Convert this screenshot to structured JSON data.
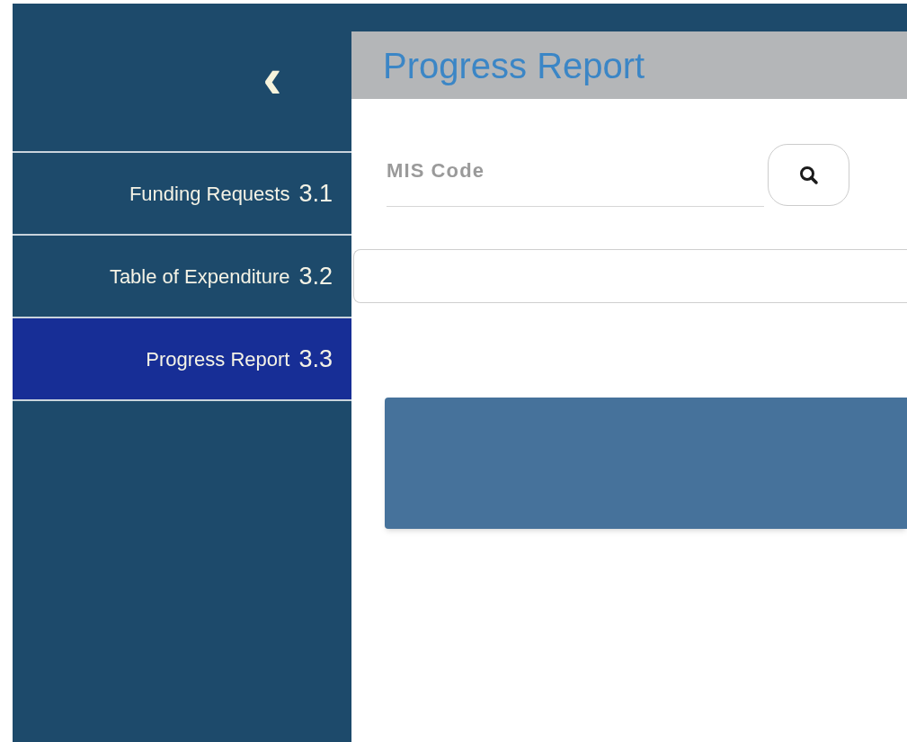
{
  "sidebar": {
    "collapse_button": "‹",
    "items": [
      {
        "label": "Funding Requests",
        "number": "3.1",
        "selected": false
      },
      {
        "label": "Table of Expenditure",
        "number": "3.2",
        "selected": false
      },
      {
        "label": "Progress Report",
        "number": "3.3",
        "selected": true
      }
    ]
  },
  "header": {
    "title": "Progress Report"
  },
  "search": {
    "placeholder": "MIS Code"
  }
}
